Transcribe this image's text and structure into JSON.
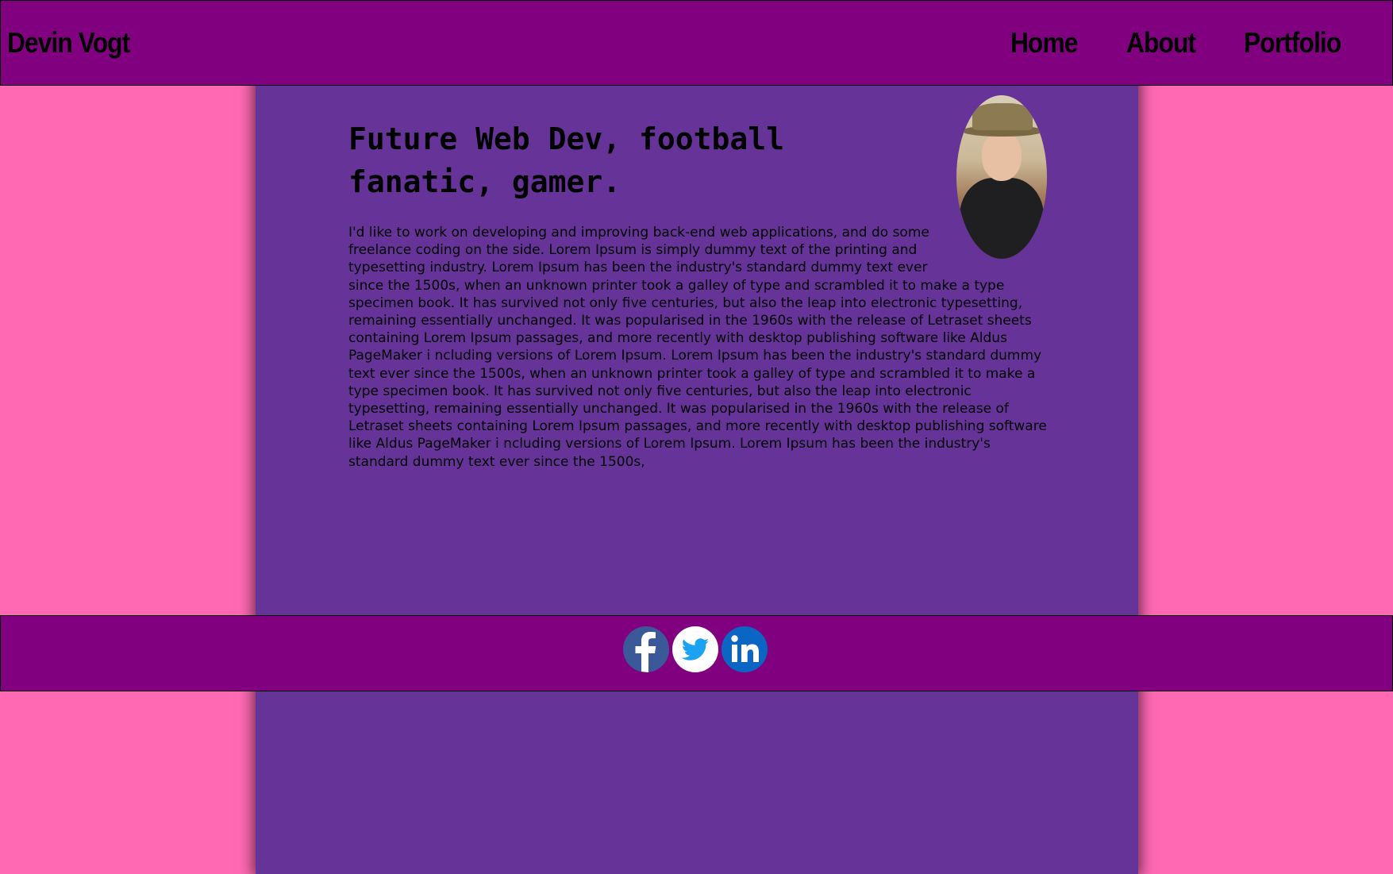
{
  "header": {
    "brand": "Devin Vogt",
    "nav": [
      {
        "label": "Home"
      },
      {
        "label": "About"
      },
      {
        "label": "Portfolio"
      }
    ]
  },
  "main": {
    "headline": "Future Web Dev, football fanatic, gamer.",
    "bio": "I'd like to work on developing and improving back-end web applications, and do some freelance coding on the side. Lorem Ipsum is simply dummy text of the printing and typesetting industry. Lorem Ipsum has been the industry's standard dummy text ever since the 1500s, when an unknown printer took a galley of type and scrambled it to make a type specimen book. It has survived not only five centuries, but also the leap into electronic typesetting, remaining essentially unchanged. It was popularised in the 1960s with the release of Letraset sheets containing Lorem Ipsum passages, and more recently with desktop publishing software like Aldus PageMaker i ncluding versions of Lorem Ipsum. Lorem Ipsum has been the industry's standard dummy text ever since the 1500s, when an unknown printer took a galley of type and scrambled it to make a type specimen book. It has survived not only five centuries, but also the leap into electronic typesetting, remaining essentially unchanged. It was popularised in the 1960s with the release of Letraset sheets containing Lorem Ipsum passages, and more recently with desktop publishing software like Aldus PageMaker i ncluding versions of Lorem Ipsum. Lorem Ipsum has been the industry's standard dummy text ever since the 1500s,"
  },
  "footer": {
    "social": [
      {
        "icon": "facebook-icon"
      },
      {
        "icon": "twitter-icon"
      },
      {
        "icon": "linkedin-icon"
      }
    ]
  },
  "colors": {
    "page_background": "#ff69b4",
    "content_column": "#663399",
    "header_footer": "#800080",
    "facebook": "#3b5998",
    "twitter": "#1da1f2",
    "linkedin": "#0a66c2"
  }
}
